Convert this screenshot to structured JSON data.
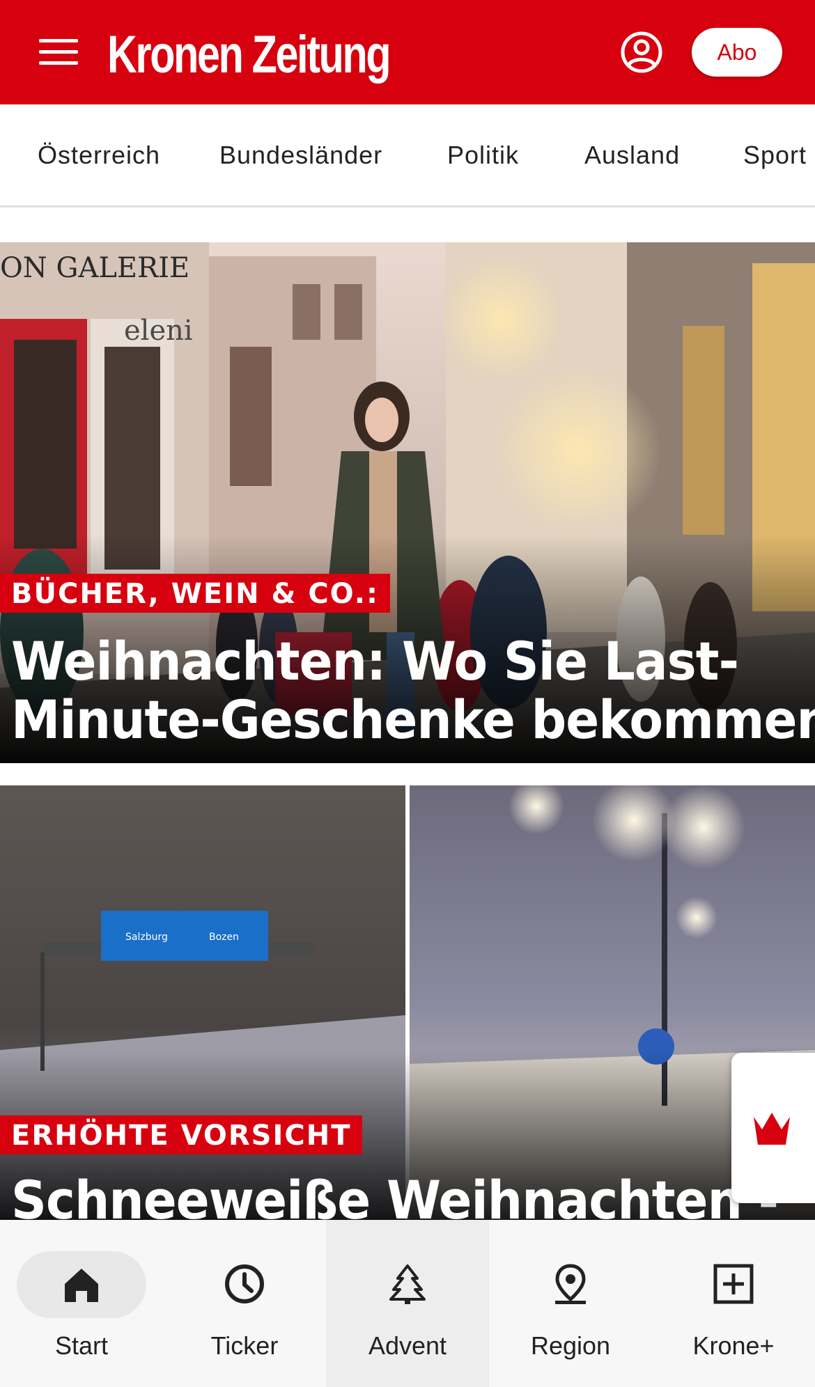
{
  "header": {
    "logo": "Kronen Zeitung",
    "abo_label": "Abo",
    "menu_icon": "hamburger-menu-icon",
    "user_icon": "user-account-icon",
    "brand_color": "#d7000f"
  },
  "categories": [
    "Österreich",
    "Bundesländer",
    "Politik",
    "Ausland",
    "Sport"
  ],
  "articles": [
    {
      "kicker": "BÜCHER, WEIN & CO.:",
      "headline_line1": "Weihnachten: Wo Sie Last-",
      "headline_line2": "Minute-Geschenke bekommen"
    },
    {
      "kicker": "ERHÖHTE VORSICHT",
      "headline_line1": "Schneeweiße Weihnachten -"
    }
  ],
  "photo_text": {
    "shop_sign": "ON GALERIE",
    "shop_name": "eleni"
  },
  "floating_button": {
    "icon": "krone-crown-icon"
  },
  "bottom_nav": {
    "items": [
      {
        "label": "Start",
        "icon": "home-icon"
      },
      {
        "label": "Ticker",
        "icon": "clock-icon"
      },
      {
        "label": "Advent",
        "icon": "tree-icon"
      },
      {
        "label": "Region",
        "icon": "location-pin-icon"
      },
      {
        "label": "Krone+",
        "icon": "plus-box-icon"
      }
    ],
    "active": "Start"
  }
}
